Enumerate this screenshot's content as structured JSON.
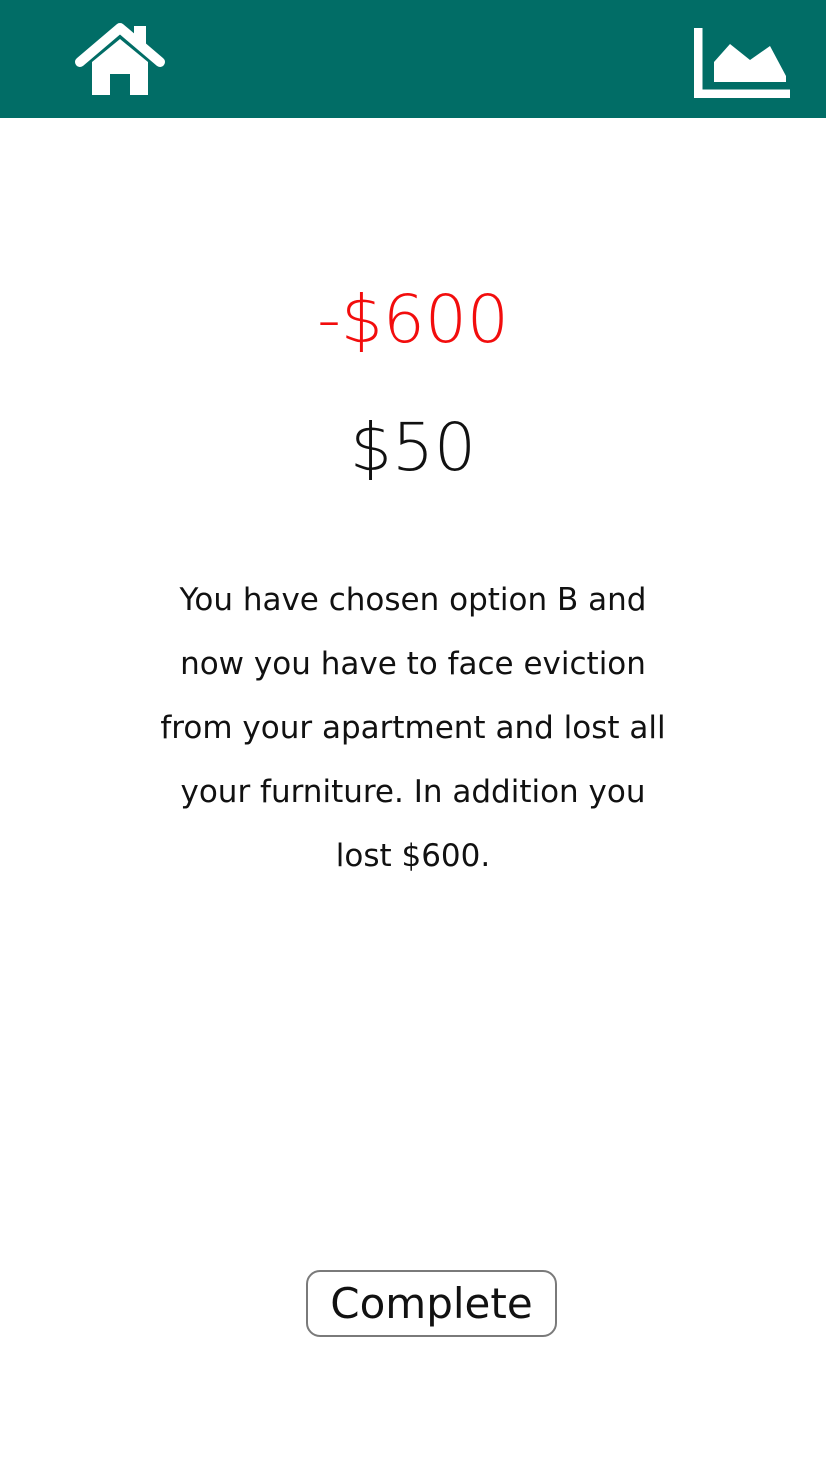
{
  "header": {
    "home_icon": "home-icon",
    "stats_icon": "area-chart-icon",
    "background_color": "#016d66"
  },
  "result": {
    "amount_change": "-$600",
    "amount_change_color": "#f20d0d",
    "balance": "$50",
    "message": "You have chosen option B and now you have to face eviction from your apartment and lost all your furniture. In addition you lost $600."
  },
  "actions": {
    "complete_label": "Complete"
  }
}
